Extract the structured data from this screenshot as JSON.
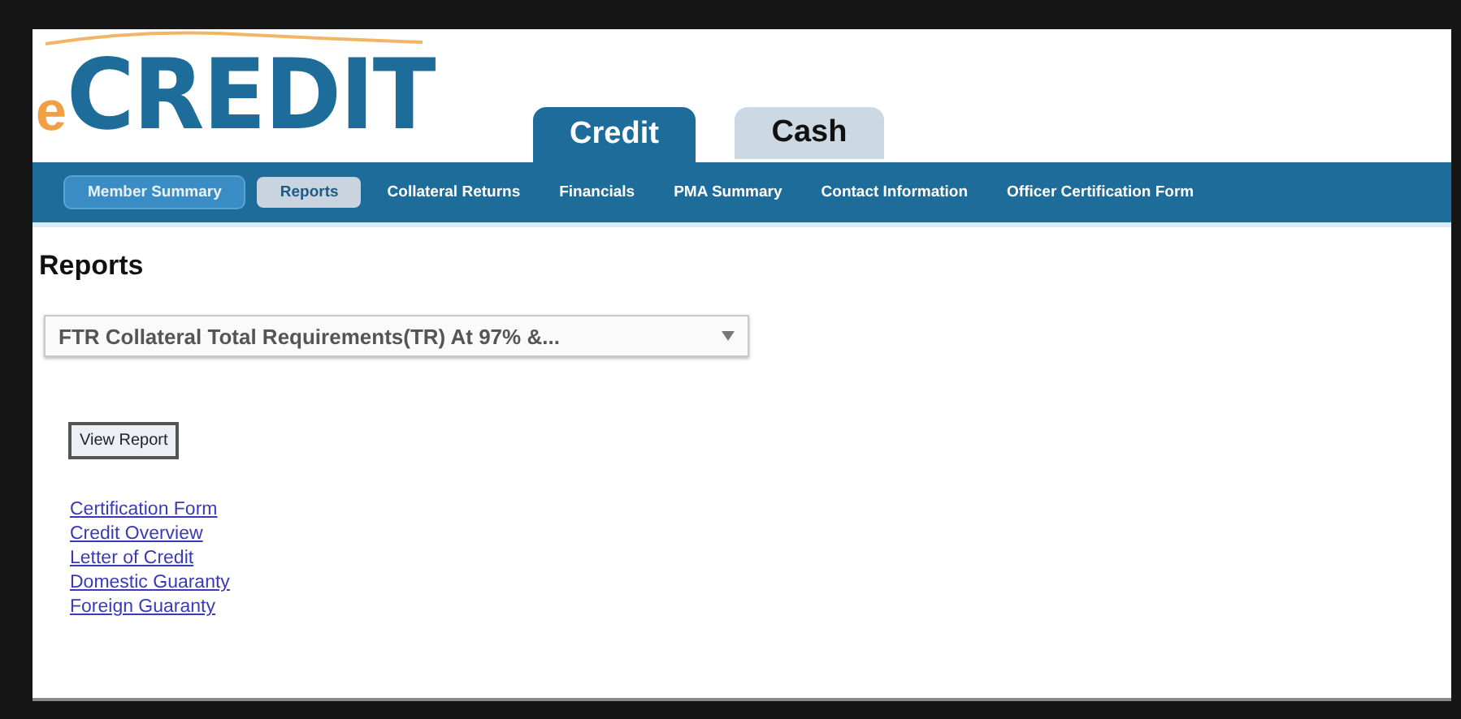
{
  "logo": {
    "prefix": "e",
    "name": "CREDIT"
  },
  "tabs": [
    {
      "label": "Credit",
      "selected": true
    },
    {
      "label": "Cash",
      "selected": false
    }
  ],
  "nav": [
    {
      "label": "Member Summary",
      "selected": false,
      "hovered": true
    },
    {
      "label": "Reports",
      "selected": true,
      "hovered": false
    },
    {
      "label": "Collateral Returns",
      "selected": false,
      "hovered": false
    },
    {
      "label": "Financials",
      "selected": false,
      "hovered": false
    },
    {
      "label": "PMA Summary",
      "selected": false,
      "hovered": false
    },
    {
      "label": "Contact Information",
      "selected": false,
      "hovered": false
    },
    {
      "label": "Officer Certification Form",
      "selected": false,
      "hovered": false
    }
  ],
  "page_title": "Reports",
  "report_select": {
    "value": "FTR Collateral Total Requirements(TR) At 97% &..."
  },
  "view_button": "View Report",
  "links": [
    "Certification Form",
    "Credit Overview",
    "Letter of Credit",
    "Domestic Guaranty",
    "Foreign Guaranty"
  ]
}
